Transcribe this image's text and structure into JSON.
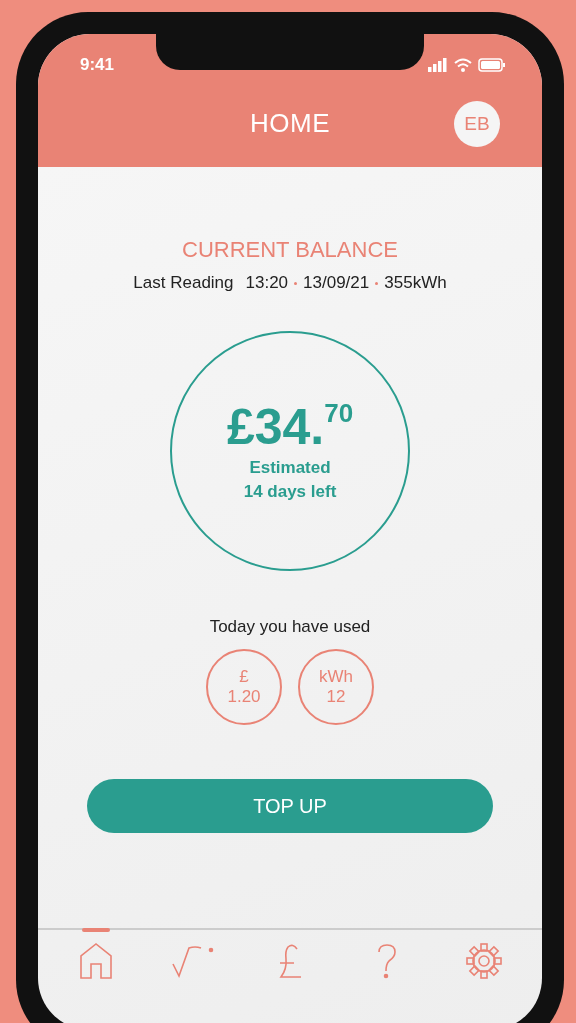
{
  "status_bar": {
    "time": "9:41"
  },
  "header": {
    "title": "HOME",
    "avatar": "EB"
  },
  "balance": {
    "heading": "CURRENT BALANCE",
    "reading_label": "Last Reading",
    "reading_parts": [
      "13:20",
      "13/09/21",
      "355kWh"
    ],
    "amount": "£34.$^{70}$",
    "estimate_lines": [
      "Estimated",
      "14 days left"
    ]
  },
  "usage": {
    "heading": "Today you have used",
    "items": [
      {
        "unit": "£",
        "value": "1.20"
      },
      {
        "unit": "kWh",
        "value": "12"
      }
    ]
  },
  "top_up_button": "TOP UP",
  "tab_bar": [
    {
      "kind": "home",
      "selected": true
    },
    {
      "kind": "graph",
      "selected": false
    },
    {
      "kind": "pound",
      "selected": false
    },
    {
      "kind": "help",
      "selected": false
    },
    {
      "kind": "settings",
      "selected": false
    }
  ]
}
